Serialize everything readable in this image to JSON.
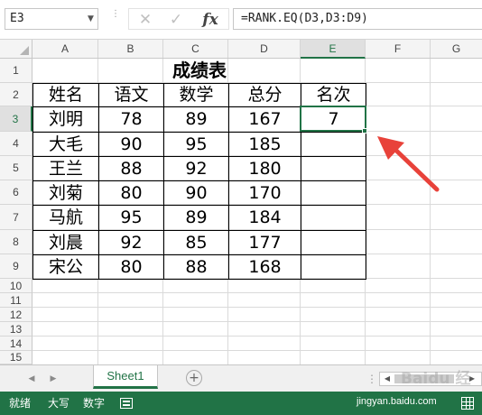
{
  "formula_bar": {
    "name_box_value": "E3",
    "cancel_symbol": "✕",
    "enter_symbol": "✓",
    "fx_label": "fx",
    "formula_text": "=RANK.EQ(D3,D3:D9)"
  },
  "columns": [
    "A",
    "B",
    "C",
    "D",
    "E",
    "F",
    "G"
  ],
  "rows": [
    "1",
    "2",
    "3",
    "4",
    "5",
    "6",
    "7",
    "8",
    "9",
    "10",
    "11",
    "12",
    "13",
    "14",
    "15"
  ],
  "table": {
    "title": "成绩表",
    "headers": [
      "姓名",
      "语文",
      "数学",
      "总分",
      "名次"
    ],
    "records": [
      {
        "name": "刘明",
        "chinese": "78",
        "math": "89",
        "total": "167",
        "rank": "7"
      },
      {
        "name": "大毛",
        "chinese": "90",
        "math": "95",
        "total": "185",
        "rank": ""
      },
      {
        "name": "王兰",
        "chinese": "88",
        "math": "92",
        "total": "180",
        "rank": ""
      },
      {
        "name": "刘菊",
        "chinese": "80",
        "math": "90",
        "total": "170",
        "rank": ""
      },
      {
        "name": "马航",
        "chinese": "95",
        "math": "89",
        "total": "184",
        "rank": ""
      },
      {
        "name": "刘晨",
        "chinese": "92",
        "math": "85",
        "total": "177",
        "rank": ""
      },
      {
        "name": "宋公",
        "chinese": "80",
        "math": "88",
        "total": "168",
        "rank": ""
      }
    ]
  },
  "selection": {
    "active_cell": "E3",
    "active_column": "E",
    "active_row": "3"
  },
  "sheet_tabs": {
    "tabs": [
      "Sheet1"
    ],
    "add_sheet_symbol": "+"
  },
  "status_bar": {
    "ready": "就绪",
    "caps": "大写",
    "num": "数字"
  },
  "watermark": {
    "text": "Baidu 经验",
    "url": "jingyan.baidu.com"
  },
  "colors": {
    "excel_green": "#217346",
    "annotation_arrow": "#e8423a"
  },
  "icons": {
    "name_box_dropdown": "chevron-down-icon",
    "cancel": "close-icon",
    "enter": "check-icon",
    "insert_function": "fx-icon",
    "add_sheet": "plus-circle-icon",
    "macro": "macro-record-icon",
    "normal_view": "grid-view-icon",
    "annotation": "red-arrow-icon"
  }
}
